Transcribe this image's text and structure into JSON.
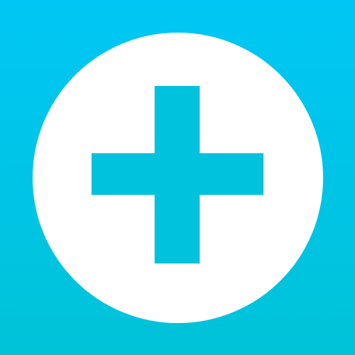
{
  "app_icon": {
    "icon": "plus-icon",
    "colors": {
      "background_top": "#00c6f5",
      "background_bottom": "#00c3d8",
      "circle": "#ffffff",
      "plus": "#00c2dd"
    }
  }
}
